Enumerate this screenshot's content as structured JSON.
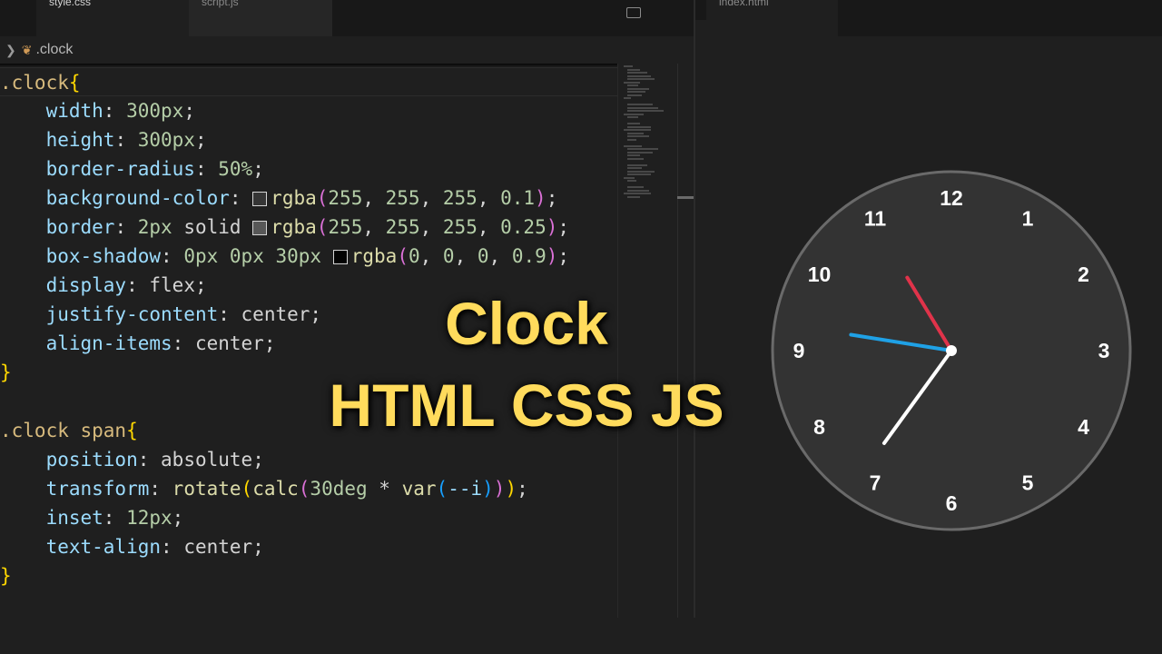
{
  "tabs": {
    "active": "style.css",
    "inactive": "script.js",
    "right": "index.html"
  },
  "breadcrumb": {
    "symbol": ".clock"
  },
  "colors": {
    "selector": "#d7ba7d",
    "property": "#9cdcfe",
    "number": "#b5cea8",
    "brace": "#ffd700",
    "function": "#dcdcaa",
    "title": "#ffdb5c",
    "clock_face": "#333333",
    "hour_hand": "#ffffff",
    "minute_hand": "#1fa1e6",
    "second_hand": "#e0334a"
  },
  "code": {
    "l1": {
      "sel": ".clock",
      "open": "{"
    },
    "l2": {
      "prop": "width",
      "num": "300px"
    },
    "l3": {
      "prop": "height",
      "num": "300px"
    },
    "l4": {
      "prop": "border-radius",
      "num": "50%"
    },
    "l5": {
      "prop": "background-color",
      "fn": "rgba",
      "args": [
        "255",
        "255",
        "255",
        "0.1"
      ]
    },
    "l6": {
      "prop": "border",
      "num": "2px",
      "kw": "solid",
      "fn": "rgba",
      "args": [
        "255",
        "255",
        "255",
        "0.25"
      ]
    },
    "l7": {
      "prop": "box-shadow",
      "nums": [
        "0px",
        "0px",
        "30px"
      ],
      "fn": "rgba",
      "args": [
        "0",
        "0",
        "0",
        "0.9"
      ]
    },
    "l8": {
      "prop": "display",
      "val": "flex"
    },
    "l9": {
      "prop": "justify-content",
      "val": "center"
    },
    "l10": {
      "prop": "align-items",
      "val": "center"
    },
    "l11": {
      "close": "}"
    },
    "l13": {
      "sel": ".clock span",
      "open": "{"
    },
    "l14": {
      "prop": "position",
      "val": "absolute"
    },
    "l15": {
      "prop": "transform",
      "fn1": "rotate",
      "fn2": "calc",
      "num": "30deg",
      "op": "*",
      "fn3": "var",
      "arg": "--i"
    },
    "l16": {
      "prop": "inset",
      "num": "12px"
    },
    "l17": {
      "prop": "text-align",
      "val": "center"
    },
    "l18": {
      "close": "}"
    }
  },
  "title": {
    "line1": "Clock",
    "line2": "HTML CSS JS"
  },
  "clock": {
    "numbers": [
      "12",
      "1",
      "2",
      "3",
      "4",
      "5",
      "6",
      "7",
      "8",
      "9",
      "10",
      "11"
    ],
    "time": {
      "hour": 7.2,
      "minute": 46.5,
      "second": 54.8
    }
  }
}
